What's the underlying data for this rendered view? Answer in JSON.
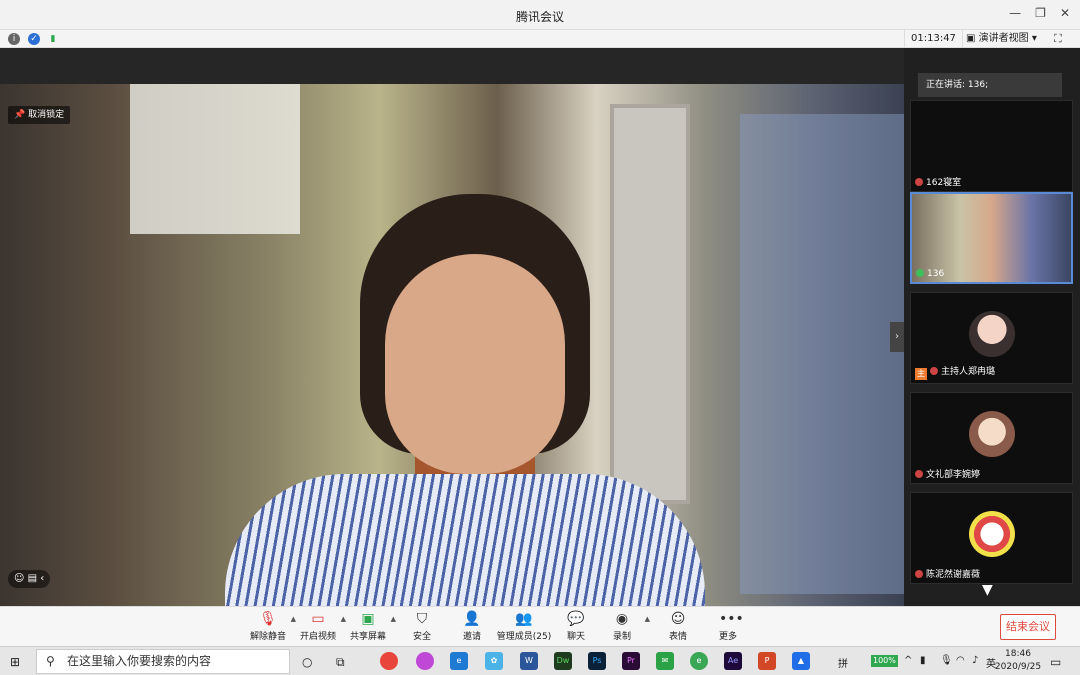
{
  "window": {
    "title": "腾讯会议"
  },
  "statusbar": {
    "timer": "01:13:47",
    "view_mode": "演讲者视图"
  },
  "stage": {
    "unlock_label": "取消锁定"
  },
  "sidebar": {
    "speaking_label": "正在讲话: 136;",
    "tiles": [
      {
        "label": "162寝室"
      },
      {
        "label": "136"
      },
      {
        "label": "主持人郑冉璐"
      },
      {
        "label": "文礼部李婉婷"
      },
      {
        "label": "陈泥然谢嘉薇"
      }
    ]
  },
  "toolbar": {
    "unmute": "解除静音",
    "video": "开启视频",
    "share": "共享屏幕",
    "security": "安全",
    "invite": "邀请",
    "members": "管理成员(25)",
    "chat": "聊天",
    "record": "录制",
    "reactions": "表情",
    "more": "更多",
    "end_meeting": "结束会议"
  },
  "taskbar": {
    "search_placeholder": "在这里输入你要搜索的内容",
    "apps": [
      "Chrome",
      "Edge",
      "Word",
      "Dw",
      "Ps",
      "Pr",
      "WeChat",
      "Ae",
      "PowerPoint",
      "Tencent Meeting"
    ],
    "battery": "100%",
    "ime": "英",
    "time": "18:46",
    "date": "2020/9/25"
  }
}
